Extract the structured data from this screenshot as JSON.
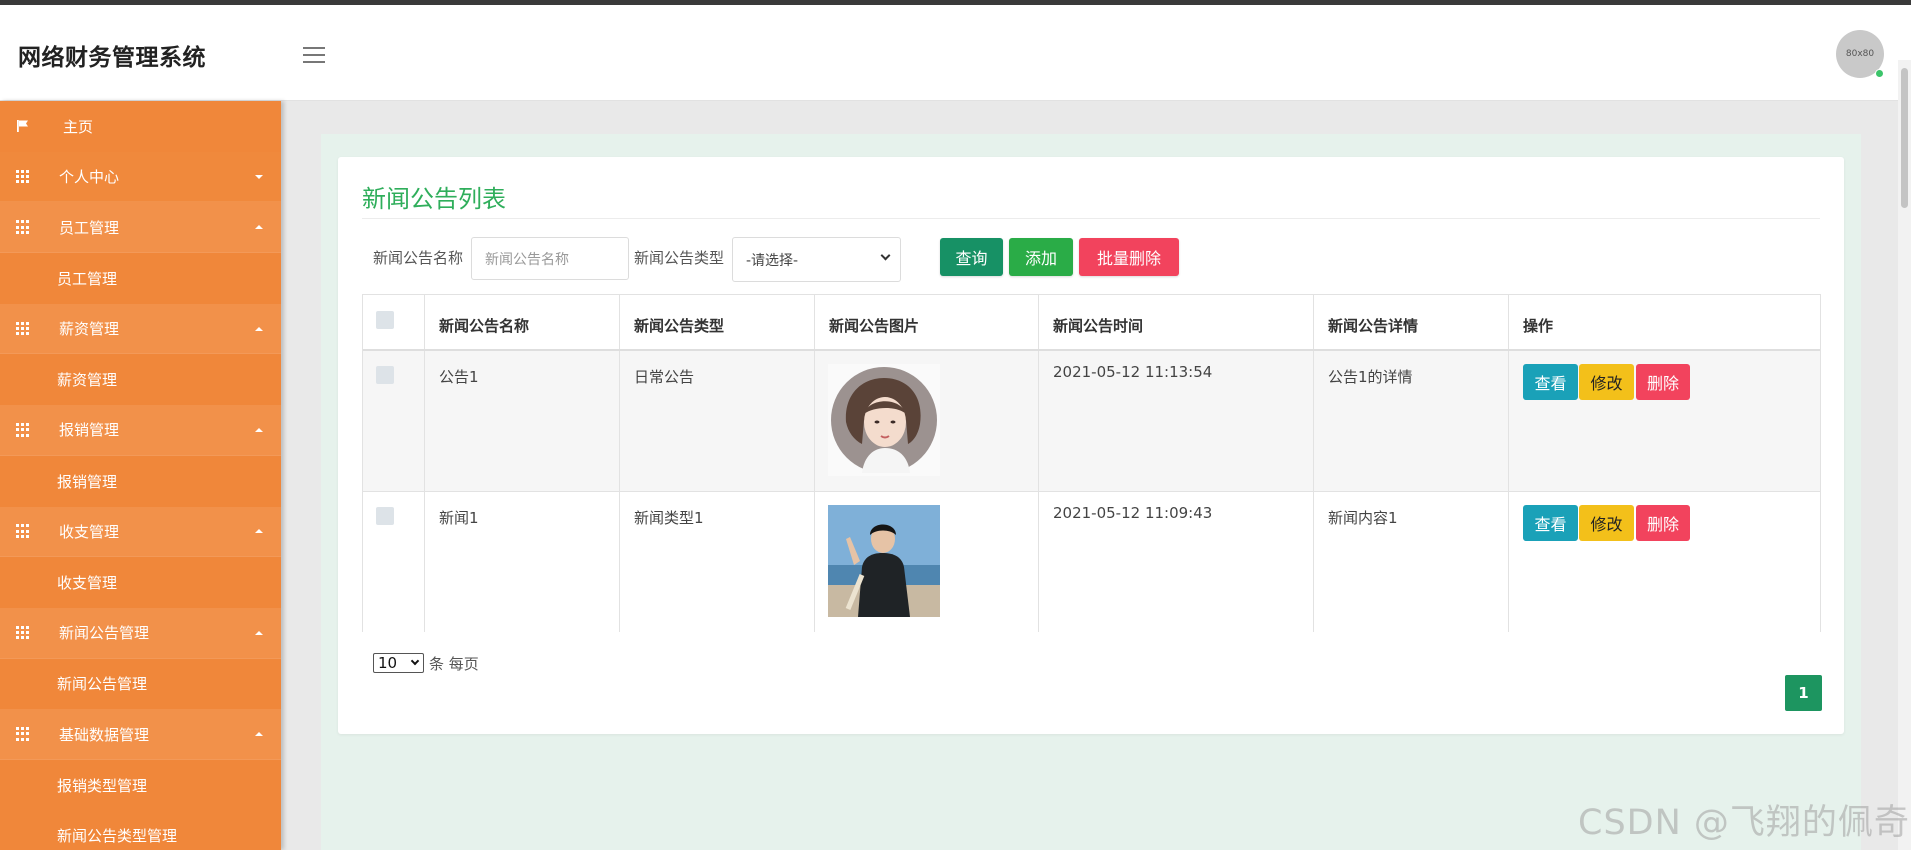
{
  "app": {
    "title": "网络财务管理系统",
    "avatar_text": "80x80"
  },
  "sidebar": {
    "items": [
      {
        "label": "主页",
        "type": "home"
      },
      {
        "label": "个人中心",
        "type": "parent",
        "open": false
      },
      {
        "label": "员工管理",
        "type": "parent",
        "open": true
      },
      {
        "label": "员工管理",
        "type": "sub"
      },
      {
        "label": "薪资管理",
        "type": "parent",
        "open": true
      },
      {
        "label": "薪资管理",
        "type": "sub"
      },
      {
        "label": "报销管理",
        "type": "parent",
        "open": true
      },
      {
        "label": "报销管理",
        "type": "sub"
      },
      {
        "label": "收支管理",
        "type": "parent",
        "open": true
      },
      {
        "label": "收支管理",
        "type": "sub"
      },
      {
        "label": "新闻公告管理",
        "type": "parent",
        "open": true
      },
      {
        "label": "新闻公告管理",
        "type": "sub"
      },
      {
        "label": "基础数据管理",
        "type": "parent",
        "open": true
      },
      {
        "label": "报销类型管理",
        "type": "sub"
      },
      {
        "label": "新闻公告类型管理",
        "type": "sub"
      }
    ]
  },
  "page": {
    "title": "新闻公告列表",
    "filters": {
      "name_label": "新闻公告名称",
      "name_placeholder": "新闻公告名称",
      "type_label": "新闻公告类型",
      "type_selected": "-请选择-"
    },
    "buttons": {
      "search": "查询",
      "add": "添加",
      "batch_delete": "批量删除"
    },
    "table": {
      "headers": [
        "新闻公告名称",
        "新闻公告类型",
        "新闻公告图片",
        "新闻公告时间",
        "新闻公告详情",
        "操作"
      ],
      "rows": [
        {
          "name": "公告1",
          "type": "日常公告",
          "time": "2021-05-12 11:13:54",
          "detail": "公告1的详情"
        },
        {
          "name": "新闻1",
          "type": "新闻类型1",
          "time": "2021-05-12 11:09:43",
          "detail": "新闻内容1"
        }
      ],
      "actions": {
        "view": "查看",
        "edit": "修改",
        "delete": "删除"
      }
    },
    "pagination": {
      "page_size": "10",
      "suffix": "条 每页",
      "current_page": "1"
    }
  },
  "watermark": "CSDN @飞翔的佩奇"
}
